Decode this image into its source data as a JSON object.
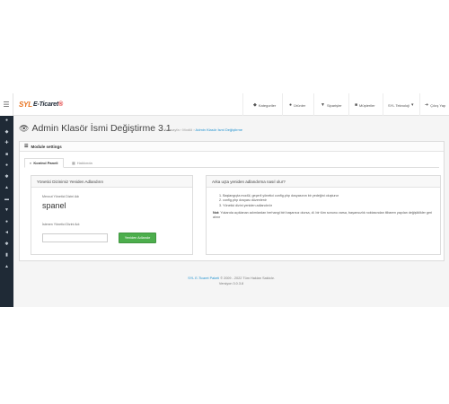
{
  "sidebar": {
    "toggle_icon": "hamburger-icon",
    "items": [
      {
        "icon": "dashboard-icon",
        "glyph": "●"
      },
      {
        "icon": "tag-icon",
        "glyph": "◆"
      },
      {
        "icon": "puzzle-icon",
        "glyph": "✚"
      },
      {
        "icon": "desktop-icon",
        "glyph": "■"
      },
      {
        "icon": "user-icon",
        "glyph": "●"
      },
      {
        "icon": "cog-icon",
        "glyph": "✱"
      },
      {
        "icon": "fire-icon",
        "glyph": "▲"
      },
      {
        "icon": "monitor-icon",
        "glyph": "▬"
      },
      {
        "icon": "cart-icon",
        "glyph": "▼"
      },
      {
        "icon": "person-icon",
        "glyph": "●"
      },
      {
        "icon": "share-icon",
        "glyph": "◄"
      },
      {
        "icon": "gear-icon",
        "glyph": "✱"
      },
      {
        "icon": "chart-icon",
        "glyph": "▮"
      },
      {
        "icon": "bell-icon",
        "glyph": "▲"
      }
    ]
  },
  "topbar": {
    "logo": {
      "part1": "SYL",
      "part2": "E-Ticaret",
      "part3": "®"
    },
    "items": {
      "categories": "Kategoriler",
      "products": "Ürünler",
      "orders": "Siparişler",
      "customers": "Müşteriler",
      "user": "SYL Teknoloji",
      "logout": "Çıkış Yap"
    }
  },
  "page": {
    "title": "Admin Klasör İsmi Değiştirme 3.1",
    "breadcrumb": {
      "home": "Anasayfa",
      "sep": "›",
      "modules": "Modül",
      "current": "Admin Klasör İsmi Değiştirme"
    }
  },
  "panel": {
    "heading": "Module settings",
    "tabs": {
      "control": "Kontrol Paneli",
      "about": "Hakkında"
    }
  },
  "rename_card": {
    "title": "Yönetici Dizinimiz Yeniden Adlandırın",
    "current_label": "Mevcut Yönetici Dizini Adı",
    "current_value": "spanel",
    "new_label": "İstenen Yönetici Dizini Adı",
    "new_value": "",
    "new_placeholder": "",
    "button": "Yeniden Adlandır"
  },
  "info_card": {
    "title": "Arka uçta yeniden adlandırma nasıl olur?",
    "steps": [
      "1. Başlangıçta modül, geçerli yönetici config.php dosyasının bir yedeğini oluşturur",
      "2. config.php dosyası düzenlenir",
      "3. Yönetici dizini yeniden adlandırılır"
    ],
    "note_label": "Not:",
    "note_text": "Yukarıda açıklanan adımlardan herhangi biri başarısız olursa, di. bir tüm sonunu varsa, başarısızlık noktasından itibaren yapılan değişiklikler geri alınır"
  },
  "footer": {
    "brand": "SYL E-Ticaret Paketi",
    "copyright": "© 2009 - 2022 Tüm Hakları Saklıdır.",
    "version": "Versiyon 3.0.3.8"
  },
  "colors": {
    "sidebar": "#1f2a36",
    "accent_blue": "#1e91cf",
    "button_green": "#4cae4c",
    "logo_orange": "#e8731f"
  }
}
